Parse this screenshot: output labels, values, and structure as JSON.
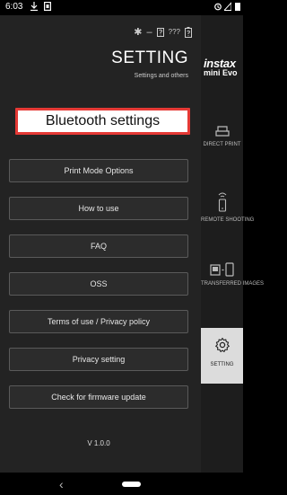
{
  "status_bar": {
    "time": "6:03",
    "left_icons": [
      "download-icon",
      "sim-icon"
    ],
    "right_icons": [
      "alarm-icon",
      "signal-icon",
      "battery-icon"
    ]
  },
  "top_icons": {
    "bluetooth": "✱",
    "dash": "–",
    "unknown": "???",
    "items": [
      "bluetooth-icon",
      "device-status-icon",
      "battery-outline-icon"
    ]
  },
  "header": {
    "title": "SETTING",
    "subtitle": "Settings and others"
  },
  "brand": {
    "top": "instax",
    "bottom": "mini Evo"
  },
  "menu": {
    "primary": "Bluetooth settings",
    "items": [
      "Print Mode Options",
      "How to use",
      "FAQ",
      "OSS",
      "Terms of use / Privacy policy",
      "Privacy setting",
      "Check for firmware update"
    ],
    "version": "V 1.0.0"
  },
  "side_nav": {
    "items": [
      {
        "label": "DIRECT PRINT",
        "icon": "printer-icon"
      },
      {
        "label": "REMOTE SHOOTING",
        "icon": "phone-remote-icon"
      },
      {
        "label": "TRANSFERRED IMAGES",
        "icon": "transfer-icon"
      },
      {
        "label": "SETTING",
        "icon": "gear-icon"
      }
    ],
    "active": "SETTING"
  },
  "nav_bar": {
    "back": "‹"
  },
  "colors": {
    "background": "#232323",
    "highlight_border": "#e53935",
    "active_tab": "#dcdcdc"
  }
}
